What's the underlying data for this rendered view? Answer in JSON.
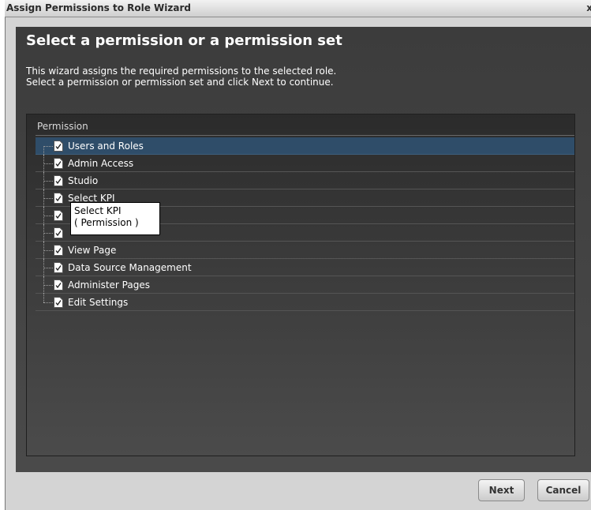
{
  "window": {
    "title": "Assign Permissions to Role Wizard",
    "close_label": "x"
  },
  "wizard": {
    "heading": "Select a permission or a permission set",
    "description_line1": "This wizard assigns the required permissions to the selected role.",
    "description_line2": "Select a permission or permission set and click Next to continue."
  },
  "tree": {
    "column_header": "Permission",
    "items": [
      {
        "label": "Users and Roles",
        "selected": true,
        "icon": "document-check-icon"
      },
      {
        "label": "Admin Access",
        "icon": "document-check-icon"
      },
      {
        "label": "Studio",
        "icon": "document-check-icon"
      },
      {
        "label": "Select KPI",
        "icon": "document-check-icon"
      },
      {
        "label": "",
        "icon": "document-check-icon"
      },
      {
        "label": "",
        "icon": "document-check-icon"
      },
      {
        "label": "View Page",
        "icon": "document-check-icon"
      },
      {
        "label": "Data Source Management",
        "icon": "document-check-icon"
      },
      {
        "label": "Administer Pages",
        "icon": "document-check-icon"
      },
      {
        "label": "Edit Settings",
        "icon": "document-check-icon"
      }
    ]
  },
  "tooltip": {
    "line1": "Select KPI",
    "line2": "( Permission )"
  },
  "buttons": {
    "next": "Next",
    "cancel": "Cancel"
  },
  "colors": {
    "selected_row": "#2f4d69",
    "panel_bg": "#3a3a3a",
    "heading_text": "#ffffff"
  }
}
